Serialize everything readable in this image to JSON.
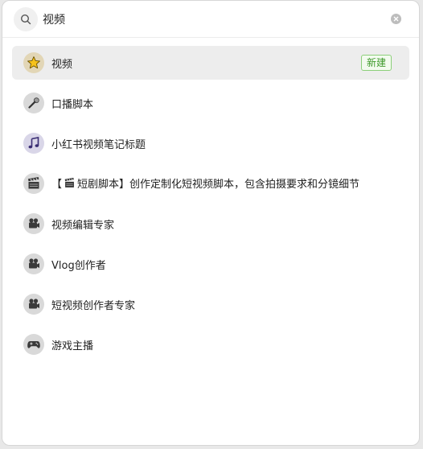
{
  "search": {
    "value": "视频",
    "placeholder": ""
  },
  "results": [
    {
      "label": "视频",
      "icon": "star-icon",
      "badge": "新建",
      "selected": true
    },
    {
      "label": "口播脚本",
      "icon": "microphone-icon"
    },
    {
      "label": "小红书视频笔记标题",
      "icon": "music-note-icon"
    },
    {
      "label_prefix": "【",
      "label_inline_icon": "clapperboard-icon",
      "label_rest": "短剧脚本】创作定制化短视频脚本，包含拍摄要求和分镜细节",
      "icon": "clapperboard-icon"
    },
    {
      "label": "视频编辑专家",
      "icon": "video-camera-icon"
    },
    {
      "label": "Vlog创作者",
      "icon": "video-camera-icon"
    },
    {
      "label": "短视频创作者专家",
      "icon": "video-camera-icon"
    },
    {
      "label": "游戏主播",
      "icon": "gamepad-icon"
    }
  ],
  "colors": {
    "selected_row": "#ededed",
    "badge_text": "#3f9a2c",
    "badge_border": "#8ccf7a"
  }
}
